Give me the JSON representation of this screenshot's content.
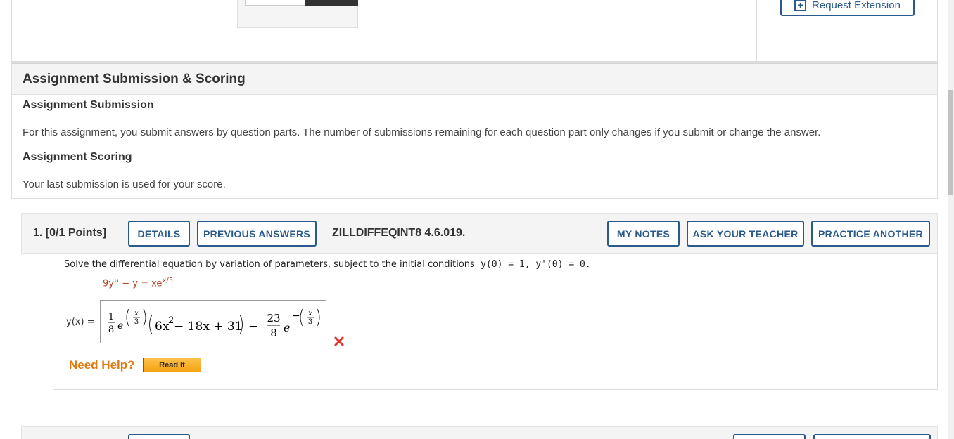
{
  "top": {
    "request_extension_label": "Request Extension"
  },
  "scoring": {
    "title": "Assignment Submission & Scoring",
    "submission_heading": "Assignment Submission",
    "submission_text": "For this assignment, you submit answers by question parts. The number of submissions remaining for each question part only changes if you submit or change the answer.",
    "scoring_heading": "Assignment Scoring",
    "scoring_text": "Your last submission is used for your score."
  },
  "question": {
    "number": "1.",
    "points": "[0/1 Points]",
    "code": "ZILLDIFFEQINT8 4.6.019.",
    "buttons": {
      "details": "DETAILS",
      "previous_answers": "PREVIOUS ANSWERS",
      "my_notes": "MY NOTES",
      "ask_teacher": "ASK YOUR TEACHER",
      "practice_another": "PRACTICE ANOTHER"
    },
    "prompt_text": "Solve the differential equation by variation of parameters, subject to the initial conditions",
    "initial_conditions": "y(0) = 1, y'(0) = 0.",
    "equation": "9y'' − y = xe",
    "equation_exponent": "x/3",
    "answer_label": "y(x) =",
    "answer": {
      "coef1_num": "1",
      "coef1_den": "8",
      "e1": "e",
      "exp1_num": "x",
      "exp1_den": "3",
      "poly": "6x",
      "poly_exp": "2",
      "poly_rest": " − 18x + 31",
      "minus": "−",
      "coef2_num": "23",
      "coef2_den": "8",
      "e2": "e",
      "exp2_sign": "−",
      "exp2_num": "x",
      "exp2_den": "3"
    },
    "answer_status": "incorrect",
    "need_help": "Need Help?",
    "read_it": "Read It"
  },
  "colors": {
    "accent": "#2a5a8c",
    "incorrect": "#e0332b",
    "help": "#e07a10"
  }
}
